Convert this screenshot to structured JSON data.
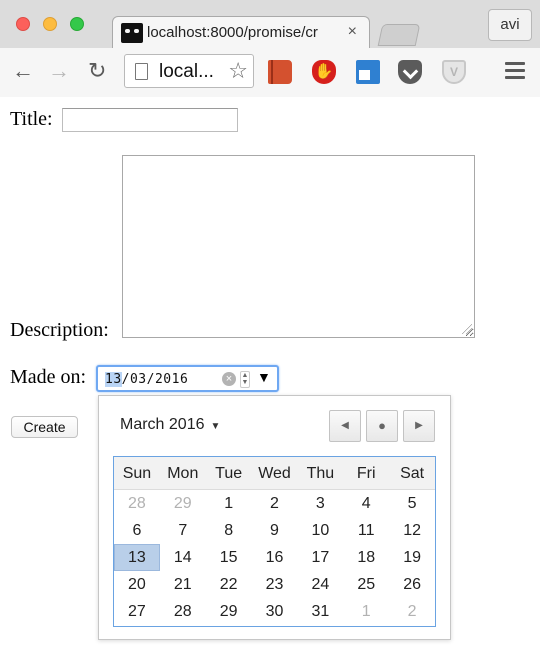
{
  "browser": {
    "tab_title": "localhost:8000/promise/cr",
    "tab_close": "×",
    "profile": "avi",
    "omnibox_text": "local...",
    "star": "☆",
    "back": "←",
    "forward": "→",
    "reload": "↻"
  },
  "form": {
    "title_label": "Title:",
    "title_value": "",
    "description_label": "Description:",
    "description_value": "",
    "made_on_label": "Made on:",
    "date_day": "13",
    "date_rest": "/03/2016",
    "create_label": "Create"
  },
  "datepicker": {
    "month_label": "March 2016",
    "month_caret": "▼",
    "prev": "◀",
    "today": "●",
    "next": "▶",
    "weekdays": [
      "Sun",
      "Mon",
      "Tue",
      "Wed",
      "Thu",
      "Fri",
      "Sat"
    ],
    "weeks": [
      [
        "28",
        "29",
        "1",
        "2",
        "3",
        "4",
        "5"
      ],
      [
        "6",
        "7",
        "8",
        "9",
        "10",
        "11",
        "12"
      ],
      [
        "13",
        "14",
        "15",
        "16",
        "17",
        "18",
        "19"
      ],
      [
        "20",
        "21",
        "22",
        "23",
        "24",
        "25",
        "26"
      ],
      [
        "27",
        "28",
        "29",
        "30",
        "31",
        "1",
        "2"
      ]
    ],
    "selected_day": "13"
  }
}
